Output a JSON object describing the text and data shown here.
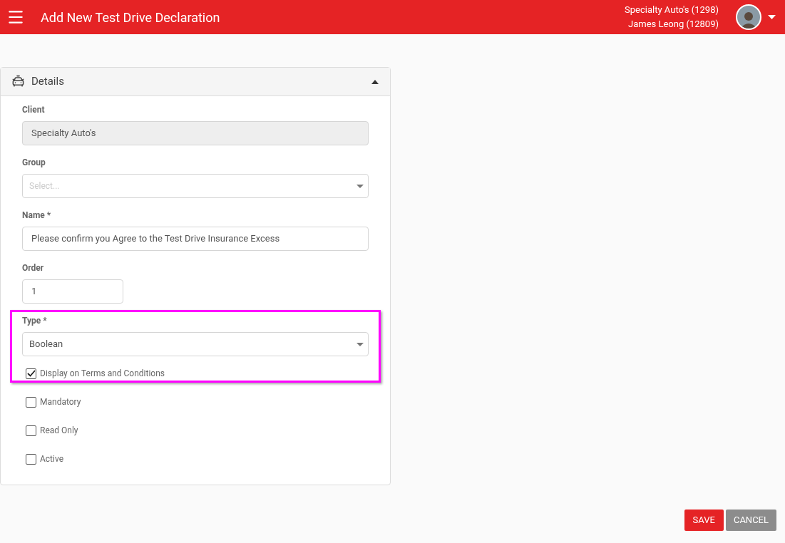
{
  "header": {
    "title": "Add New Test Drive Declaration",
    "account": "Specialty Auto's (1298)",
    "user": "James Leong (12809)"
  },
  "panel": {
    "title": "Details",
    "expanded": true,
    "fields": [
      {
        "kind": "text",
        "label": "Client",
        "value": "Specialty Auto's",
        "disabled": true,
        "highlighted": false
      },
      {
        "kind": "select",
        "label": "Group",
        "placeholder": "Select...",
        "highlighted": false
      },
      {
        "kind": "text",
        "label": "Name *",
        "value": "Please confirm you Agree to the Test Drive Insurance Excess",
        "disabled": false,
        "highlighted": false
      },
      {
        "kind": "number",
        "label": "Order",
        "value": "1",
        "highlighted": false
      },
      {
        "kind": "select",
        "label": "Type *",
        "value": "Boolean",
        "highlighted": true
      },
      {
        "kind": "checkbox",
        "label": "Display on Terms and Conditions",
        "checked": true,
        "highlighted": true
      },
      {
        "kind": "checkbox",
        "label": "Mandatory",
        "checked": false,
        "highlighted": false
      },
      {
        "kind": "checkbox",
        "label": "Read Only",
        "checked": false,
        "highlighted": false
      },
      {
        "kind": "checkbox",
        "label": "Active",
        "checked": false,
        "highlighted": false
      }
    ]
  },
  "buttons": [
    {
      "label": "SAVE",
      "kind": "primary"
    },
    {
      "label": "CANCEL",
      "kind": "secondary"
    }
  ]
}
